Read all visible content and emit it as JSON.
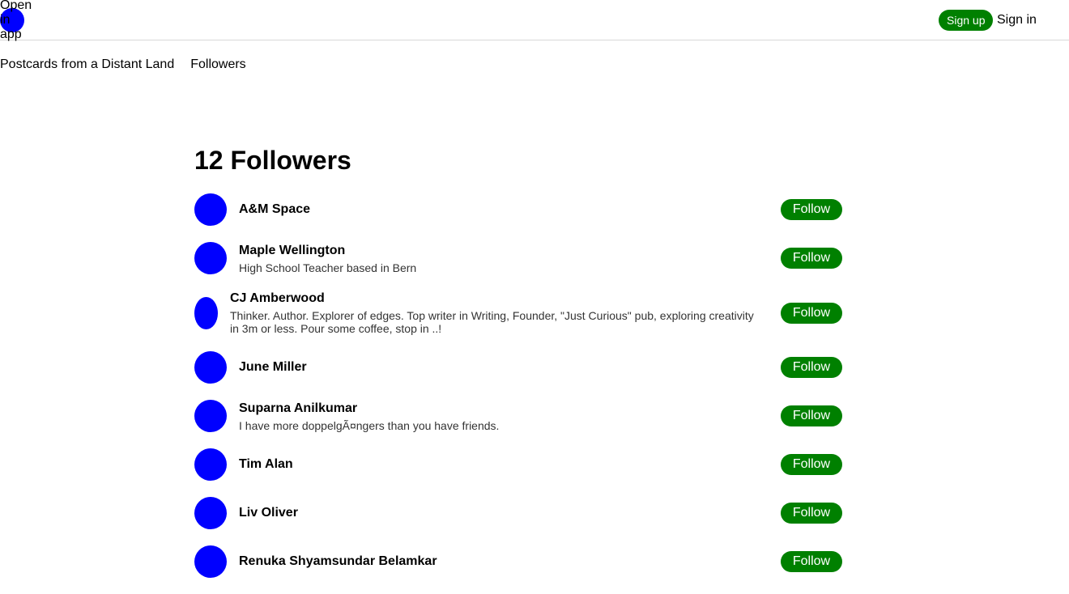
{
  "header": {
    "open_app_label": "Open in app",
    "signup_label": "Sign up",
    "signin_label": "Sign in"
  },
  "subnav": {
    "publication": "Postcards from a Distant Land",
    "followers": "Followers"
  },
  "page": {
    "title": "12 Followers"
  },
  "followers": [
    {
      "name": "A&M Space",
      "bio": "",
      "button": "Follow"
    },
    {
      "name": "Maple Wellington",
      "bio": "High School Teacher based in Bern",
      "button": "Follow"
    },
    {
      "name": "CJ Amberwood",
      "bio": "Thinker. Author. Explorer of edges. Top writer in Writing, Founder, \"Just Curious\" pub, exploring creativity in 3m or less. Pour some coffee, stop in ..!",
      "button": "Follow"
    },
    {
      "name": "June Miller",
      "bio": "",
      "button": "Follow"
    },
    {
      "name": "Suparna Anilkumar",
      "bio": "I have more doppelgÃ¤ngers than you have friends.",
      "button": "Follow"
    },
    {
      "name": "Tim Alan",
      "bio": "",
      "button": "Follow"
    },
    {
      "name": "Liv Oliver",
      "bio": "",
      "button": "Follow"
    },
    {
      "name": "Renuka Shyamsundar Belamkar",
      "bio": "",
      "button": "Follow"
    }
  ],
  "colors": {
    "accent": "#008000",
    "avatar": "#0000ff"
  }
}
